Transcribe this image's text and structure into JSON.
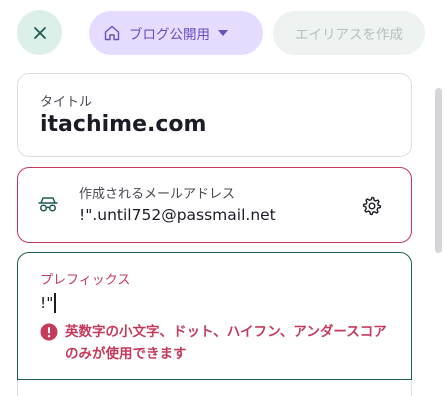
{
  "toolbar": {
    "close_icon": "close-icon",
    "mode_label": "ブログ公開用",
    "mode_icon": "home-icon",
    "create_alias_label": "エイリアスを作成"
  },
  "form": {
    "title_label": "タイトル",
    "title_value": "itachime.com",
    "email_label": "作成されるメールアドレス",
    "email_value": "!\".until752@passmail.net",
    "email_icon": "incognito-icon",
    "settings_icon": "gear-icon",
    "prefix_label": "プレフィックス",
    "prefix_value": "!\"",
    "prefix_error": "英数字の小文字、ドット、ハイフン、アンダースコアのみが使用できます"
  },
  "colors": {
    "accent_purple": "#6a4cc4",
    "error_red": "#c53a5c",
    "focus_green": "#1f5c54"
  }
}
